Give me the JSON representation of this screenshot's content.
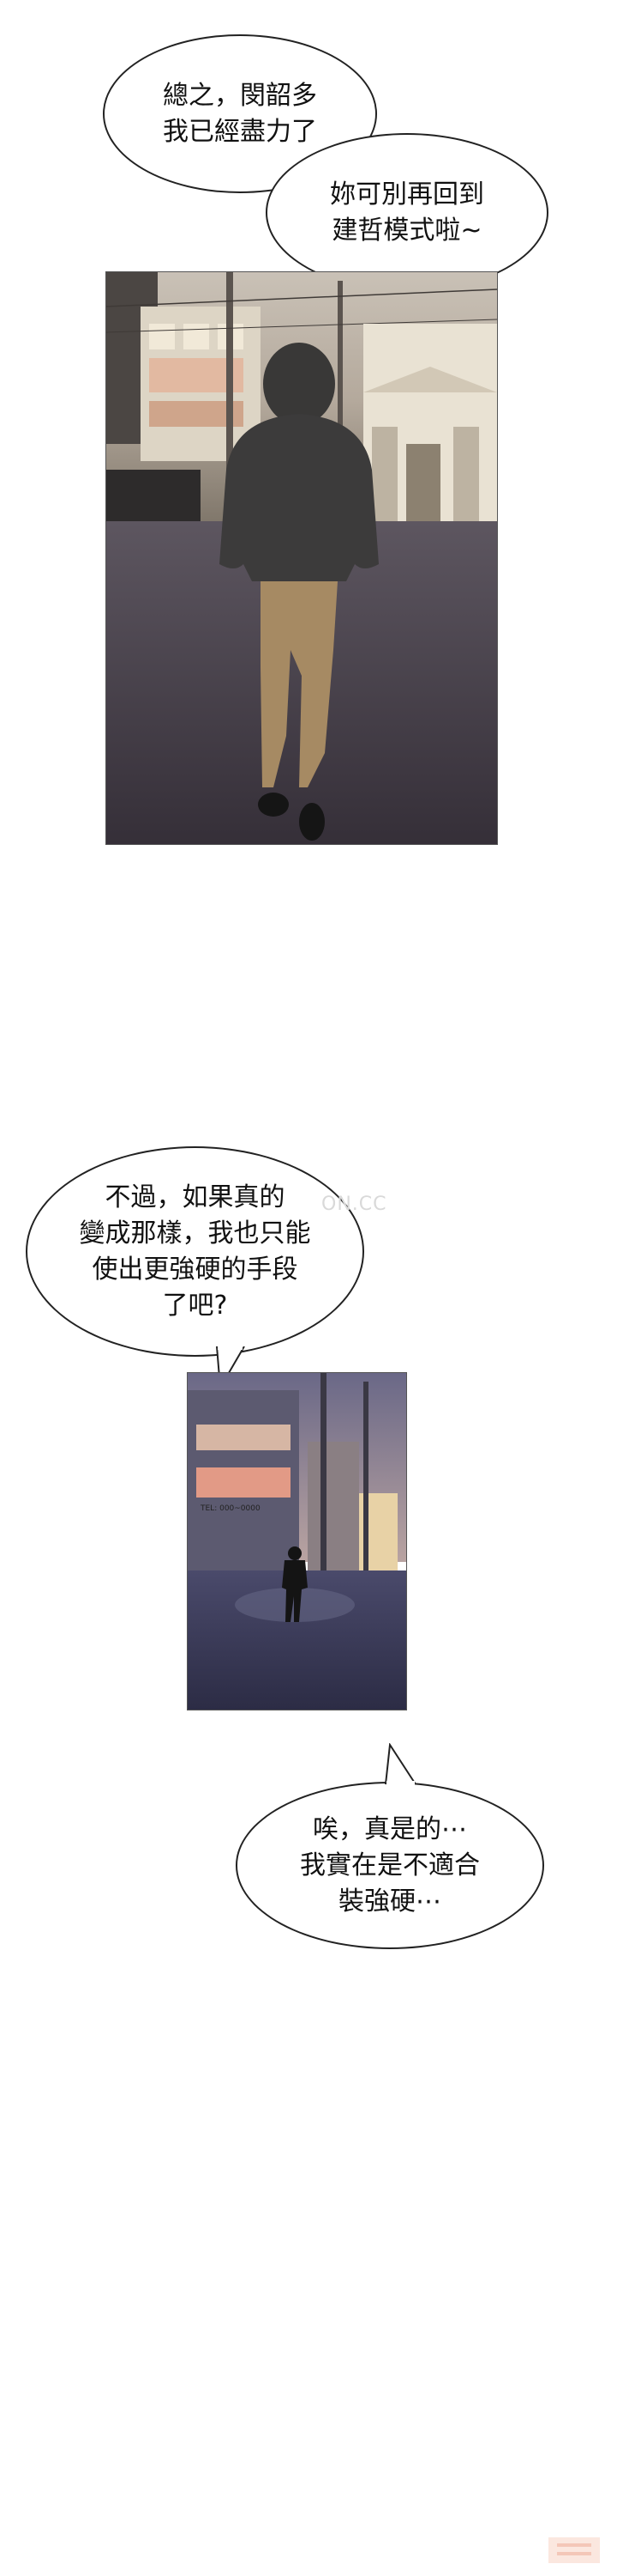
{
  "bubbles": {
    "b1": "總之，閔韶多\n我已經盡力了",
    "b2": "妳可別再回到\n建哲模式啦~",
    "b3": "不過，如果真的\n變成那樣，我也只能\n使出更強硬的手段\n了吧?",
    "b4": "唉，真是的⋯\n我實在是不適合\n裝強硬⋯"
  },
  "watermark": "ON.CC",
  "scene2_sign": "TEL: 000~0000"
}
